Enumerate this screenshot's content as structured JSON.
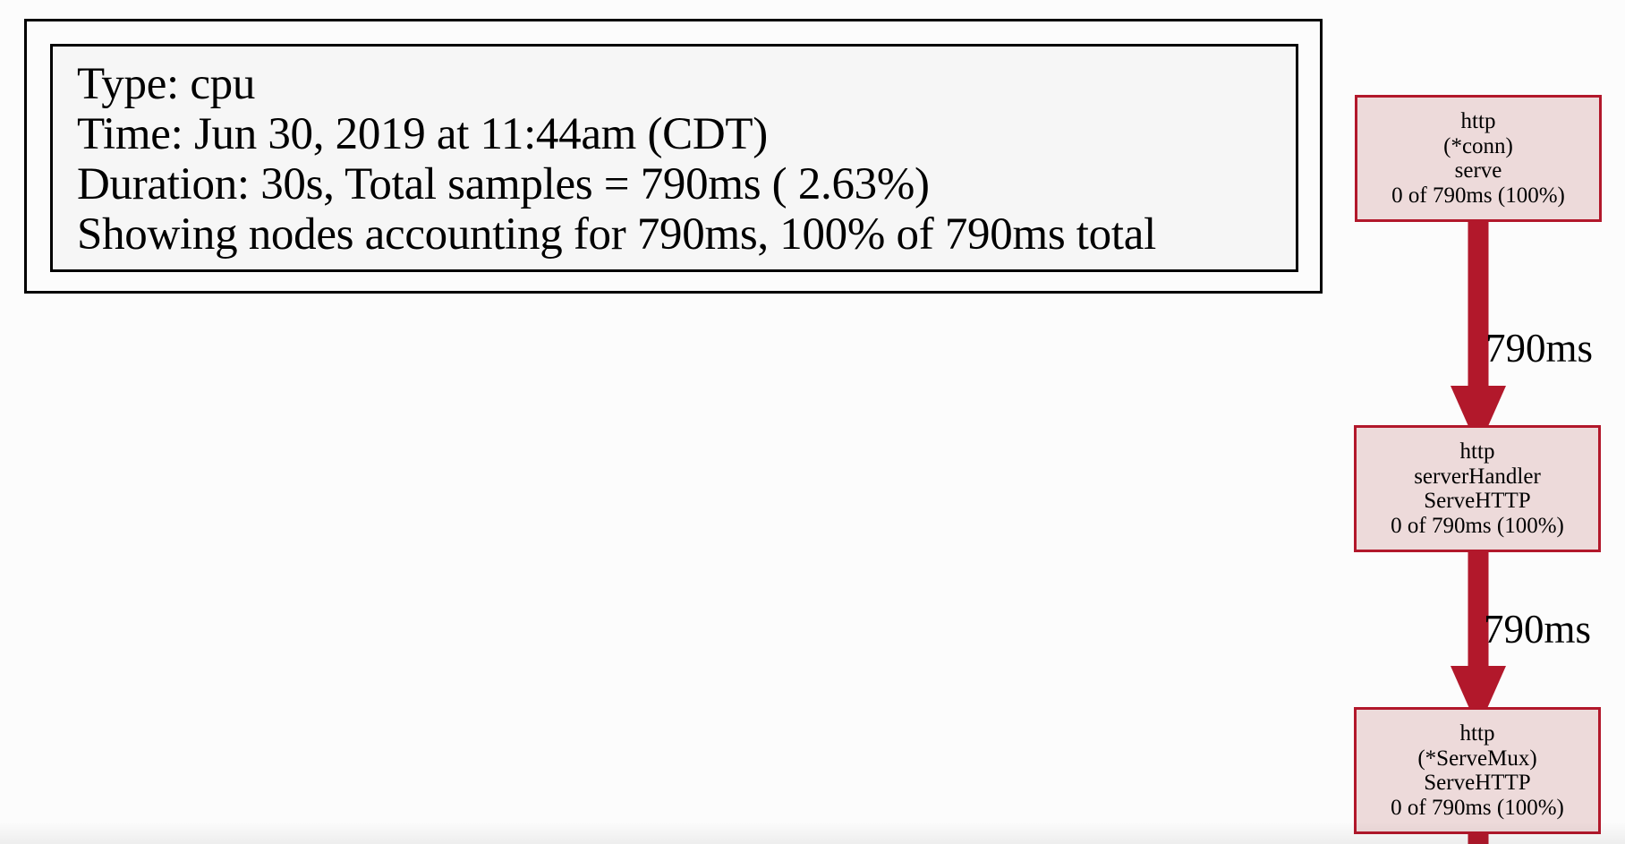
{
  "legend": {
    "lines": [
      "Type: cpu",
      "Time: Jun 30, 2019 at 11:44am (CDT)",
      "Duration: 30s, Total samples = 790ms ( 2.63%)",
      "Showing nodes accounting for 790ms, 100% of 790ms total"
    ]
  },
  "nodes": [
    {
      "package": "http",
      "receiver": "(*conn)",
      "function": "serve",
      "stats": "0 of 790ms (100%)"
    },
    {
      "package": "http",
      "receiver": "serverHandler",
      "function": "ServeHTTP",
      "stats": "0 of 790ms (100%)"
    },
    {
      "package": "http",
      "receiver": "(*ServeMux)",
      "function": "ServeHTTP",
      "stats": "0 of 790ms (100%)"
    }
  ],
  "edges": [
    {
      "label": "790ms"
    },
    {
      "label": "790ms"
    }
  ],
  "colors": {
    "edge": "#b2182b",
    "node_border": "#b2182b",
    "node_fill": "#eddada",
    "legend_fill": "#f6f6f6",
    "background": "#fcfcfc"
  }
}
